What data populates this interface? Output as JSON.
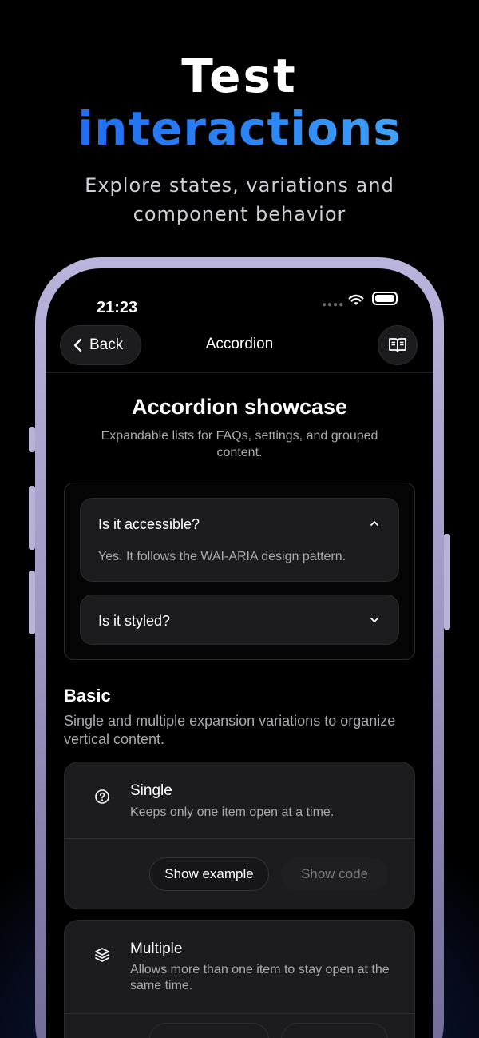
{
  "hero": {
    "line1": "Test",
    "line2": "interactions",
    "subtitle": "Explore states, variations and component behavior"
  },
  "status_bar": {
    "time": "21:23"
  },
  "nav": {
    "back_label": "Back",
    "title": "Accordion",
    "book_icon": "book-open-icon"
  },
  "header": {
    "title": "Accordion showcase",
    "subtitle": "Expandable lists for FAQs, settings, and grouped content."
  },
  "demo_accordion": {
    "items": [
      {
        "question": "Is it accessible?",
        "answer": "Yes. It follows the WAI-ARIA design pattern.",
        "expanded": true
      },
      {
        "question": "Is it styled?",
        "answer": "",
        "expanded": false
      }
    ]
  },
  "basic": {
    "title": "Basic",
    "description": "Single and multiple expansion variations to organize vertical content.",
    "cards": [
      {
        "icon": "question-circle-icon",
        "title": "Single",
        "description": "Keeps only one item open at a time.",
        "show_example": "Show example",
        "show_code": "Show code"
      },
      {
        "icon": "layers-icon",
        "title": "Multiple",
        "description": "Allows more than one item to stay open at the same time."
      }
    ]
  },
  "colors": {
    "background": "#000000",
    "accent_blue": "#2b86f5",
    "frame": "#b9b4dc",
    "card": "#1c1c1e"
  }
}
